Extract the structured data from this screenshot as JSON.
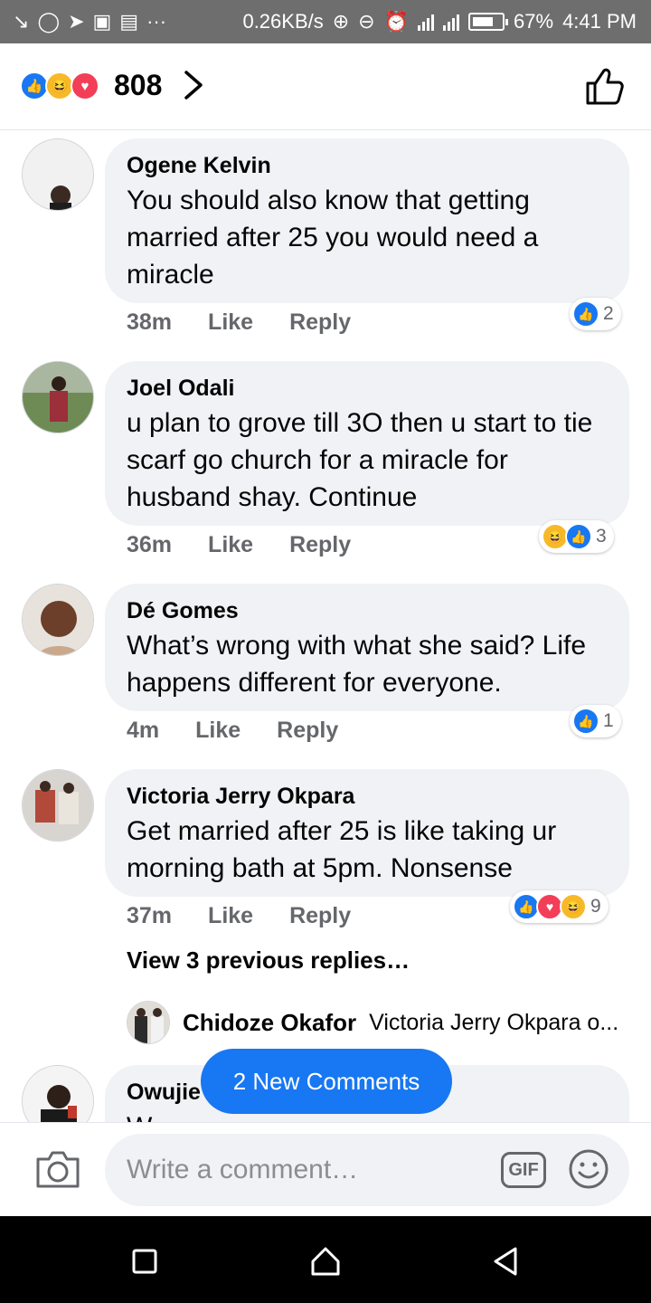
{
  "status_bar": {
    "net_speed": "0.26KB/s",
    "battery": "67%",
    "time": "4:41 PM",
    "overflow": "···"
  },
  "reactions": {
    "count": "808",
    "types": [
      "like",
      "haha",
      "love"
    ]
  },
  "comments": [
    {
      "author": "Ogene Kelvin",
      "text": "You should also know that getting married after 25 you would need a miracle",
      "time": "38m",
      "like_label": "Like",
      "reply_label": "Reply",
      "reaction_count": "2",
      "reactions": [
        "like"
      ]
    },
    {
      "author": "Joel Odali",
      "text": "u plan to grove till 3O then u start to tie scarf go church for a miracle for husband shay. Continue",
      "time": "36m",
      "like_label": "Like",
      "reply_label": "Reply",
      "reaction_count": "3",
      "reactions": [
        "haha",
        "like"
      ]
    },
    {
      "author": "Dé Gomes",
      "text": "What’s wrong with what she said? Life happens different for everyone.",
      "time": "4m",
      "like_label": "Like",
      "reply_label": "Reply",
      "reaction_count": "1",
      "reactions": [
        "like"
      ]
    },
    {
      "author": "Victoria Jerry Okpara",
      "text": "Get married after 25 is like taking ur morning bath at 5pm. Nonsense",
      "time": "37m",
      "like_label": "Like",
      "reply_label": "Reply",
      "reaction_count": "9",
      "reactions": [
        "like",
        "love",
        "haha"
      ]
    },
    {
      "author": "Owujie",
      "text": "W..."
    }
  ],
  "view_replies": "View 3 previous replies…",
  "reply_preview": {
    "author": "Chidoze Okafor",
    "text": "Victoria Jerry Okpara o..."
  },
  "new_comments_label": "2 New Comments",
  "composer": {
    "placeholder": "Write a comment…",
    "gif_label": "GIF"
  },
  "colors": {
    "brand_blue": "#1877f2",
    "bubble_bg": "#f0f2f5",
    "meta_gray": "#65676b",
    "status_bar_bg": "#6e6e6e"
  }
}
